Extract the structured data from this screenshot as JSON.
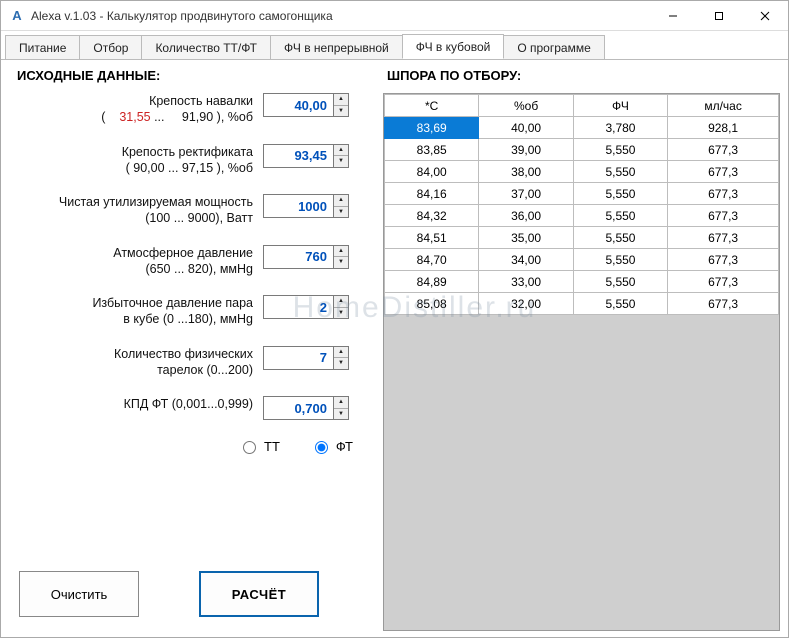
{
  "window": {
    "title": "Alexa  v.1.03 - Калькулятор продвинутого самогонщика",
    "icon_letter": "A"
  },
  "tabs": [
    {
      "label": "Питание"
    },
    {
      "label": "Отбор"
    },
    {
      "label": "Количество ТТ/ФТ"
    },
    {
      "label": "ФЧ в непрерывной"
    },
    {
      "label": "ФЧ в кубовой"
    },
    {
      "label": "О программе"
    }
  ],
  "active_tab_index": 4,
  "left": {
    "heading": "ИСХОДНЫЕ ДАННЫЕ:",
    "fields": {
      "strength_wash": {
        "label_top": "Крепость навалки",
        "range_open": "(",
        "range_low": "31,55",
        "range_dots": " ... ",
        "range_high": "91,90",
        "range_close": "   ), %об",
        "value": "40,00"
      },
      "strength_rect": {
        "label_top": "Крепость ректификата",
        "range": "(    90,00 ...    97,15 ), %об",
        "value": "93,45"
      },
      "power": {
        "label_top": "Чистая утилизируемая мощность",
        "range": "(100 ... 9000), Ватт",
        "value": "1000"
      },
      "atm_pressure": {
        "label_top": "Атмосферное давление",
        "range": "(650 ... 820), ммHg",
        "value": "760"
      },
      "overpressure": {
        "label_top": "Избыточное давление пара",
        "range": "в кубе (0 ...180), ммHg",
        "value": "2"
      },
      "plates": {
        "label_top": "Количество        физических",
        "range": "тарелок (0...200)",
        "value": "7"
      },
      "kpd": {
        "label_top": "КПД ФТ (0,001...0,999)",
        "range": "",
        "value": "0,700"
      }
    },
    "radio": {
      "tt": "ТТ",
      "ft": "ФТ",
      "selected": "ft"
    },
    "buttons": {
      "clear": "Очистить",
      "calc": "РАСЧЁТ"
    }
  },
  "right": {
    "heading": "ШПОРА ПО ОТБОРУ:",
    "columns": [
      "*C",
      "%об",
      "ФЧ",
      "мл/час"
    ],
    "selected_row": 0,
    "rows": [
      [
        "83,69",
        "40,00",
        "3,780",
        "928,1"
      ],
      [
        "83,85",
        "39,00",
        "5,550",
        "677,3"
      ],
      [
        "84,00",
        "38,00",
        "5,550",
        "677,3"
      ],
      [
        "84,16",
        "37,00",
        "5,550",
        "677,3"
      ],
      [
        "84,32",
        "36,00",
        "5,550",
        "677,3"
      ],
      [
        "84,51",
        "35,00",
        "5,550",
        "677,3"
      ],
      [
        "84,70",
        "34,00",
        "5,550",
        "677,3"
      ],
      [
        "84,89",
        "33,00",
        "5,550",
        "677,3"
      ],
      [
        "85,08",
        "32,00",
        "5,550",
        "677,3"
      ]
    ]
  },
  "watermark": "HomeDistiller.ru",
  "chart_data": {
    "type": "table",
    "title": "ШПОРА ПО ОТБОРУ",
    "columns": [
      "*C",
      "%об",
      "ФЧ",
      "мл/час"
    ],
    "rows": [
      [
        83.69,
        40.0,
        3.78,
        928.1
      ],
      [
        83.85,
        39.0,
        5.55,
        677.3
      ],
      [
        84.0,
        38.0,
        5.55,
        677.3
      ],
      [
        84.16,
        37.0,
        5.55,
        677.3
      ],
      [
        84.32,
        36.0,
        5.55,
        677.3
      ],
      [
        84.51,
        35.0,
        5.55,
        677.3
      ],
      [
        84.7,
        34.0,
        5.55,
        677.3
      ],
      [
        84.89,
        33.0,
        5.55,
        677.3
      ],
      [
        85.08,
        32.0,
        5.55,
        677.3
      ]
    ]
  }
}
